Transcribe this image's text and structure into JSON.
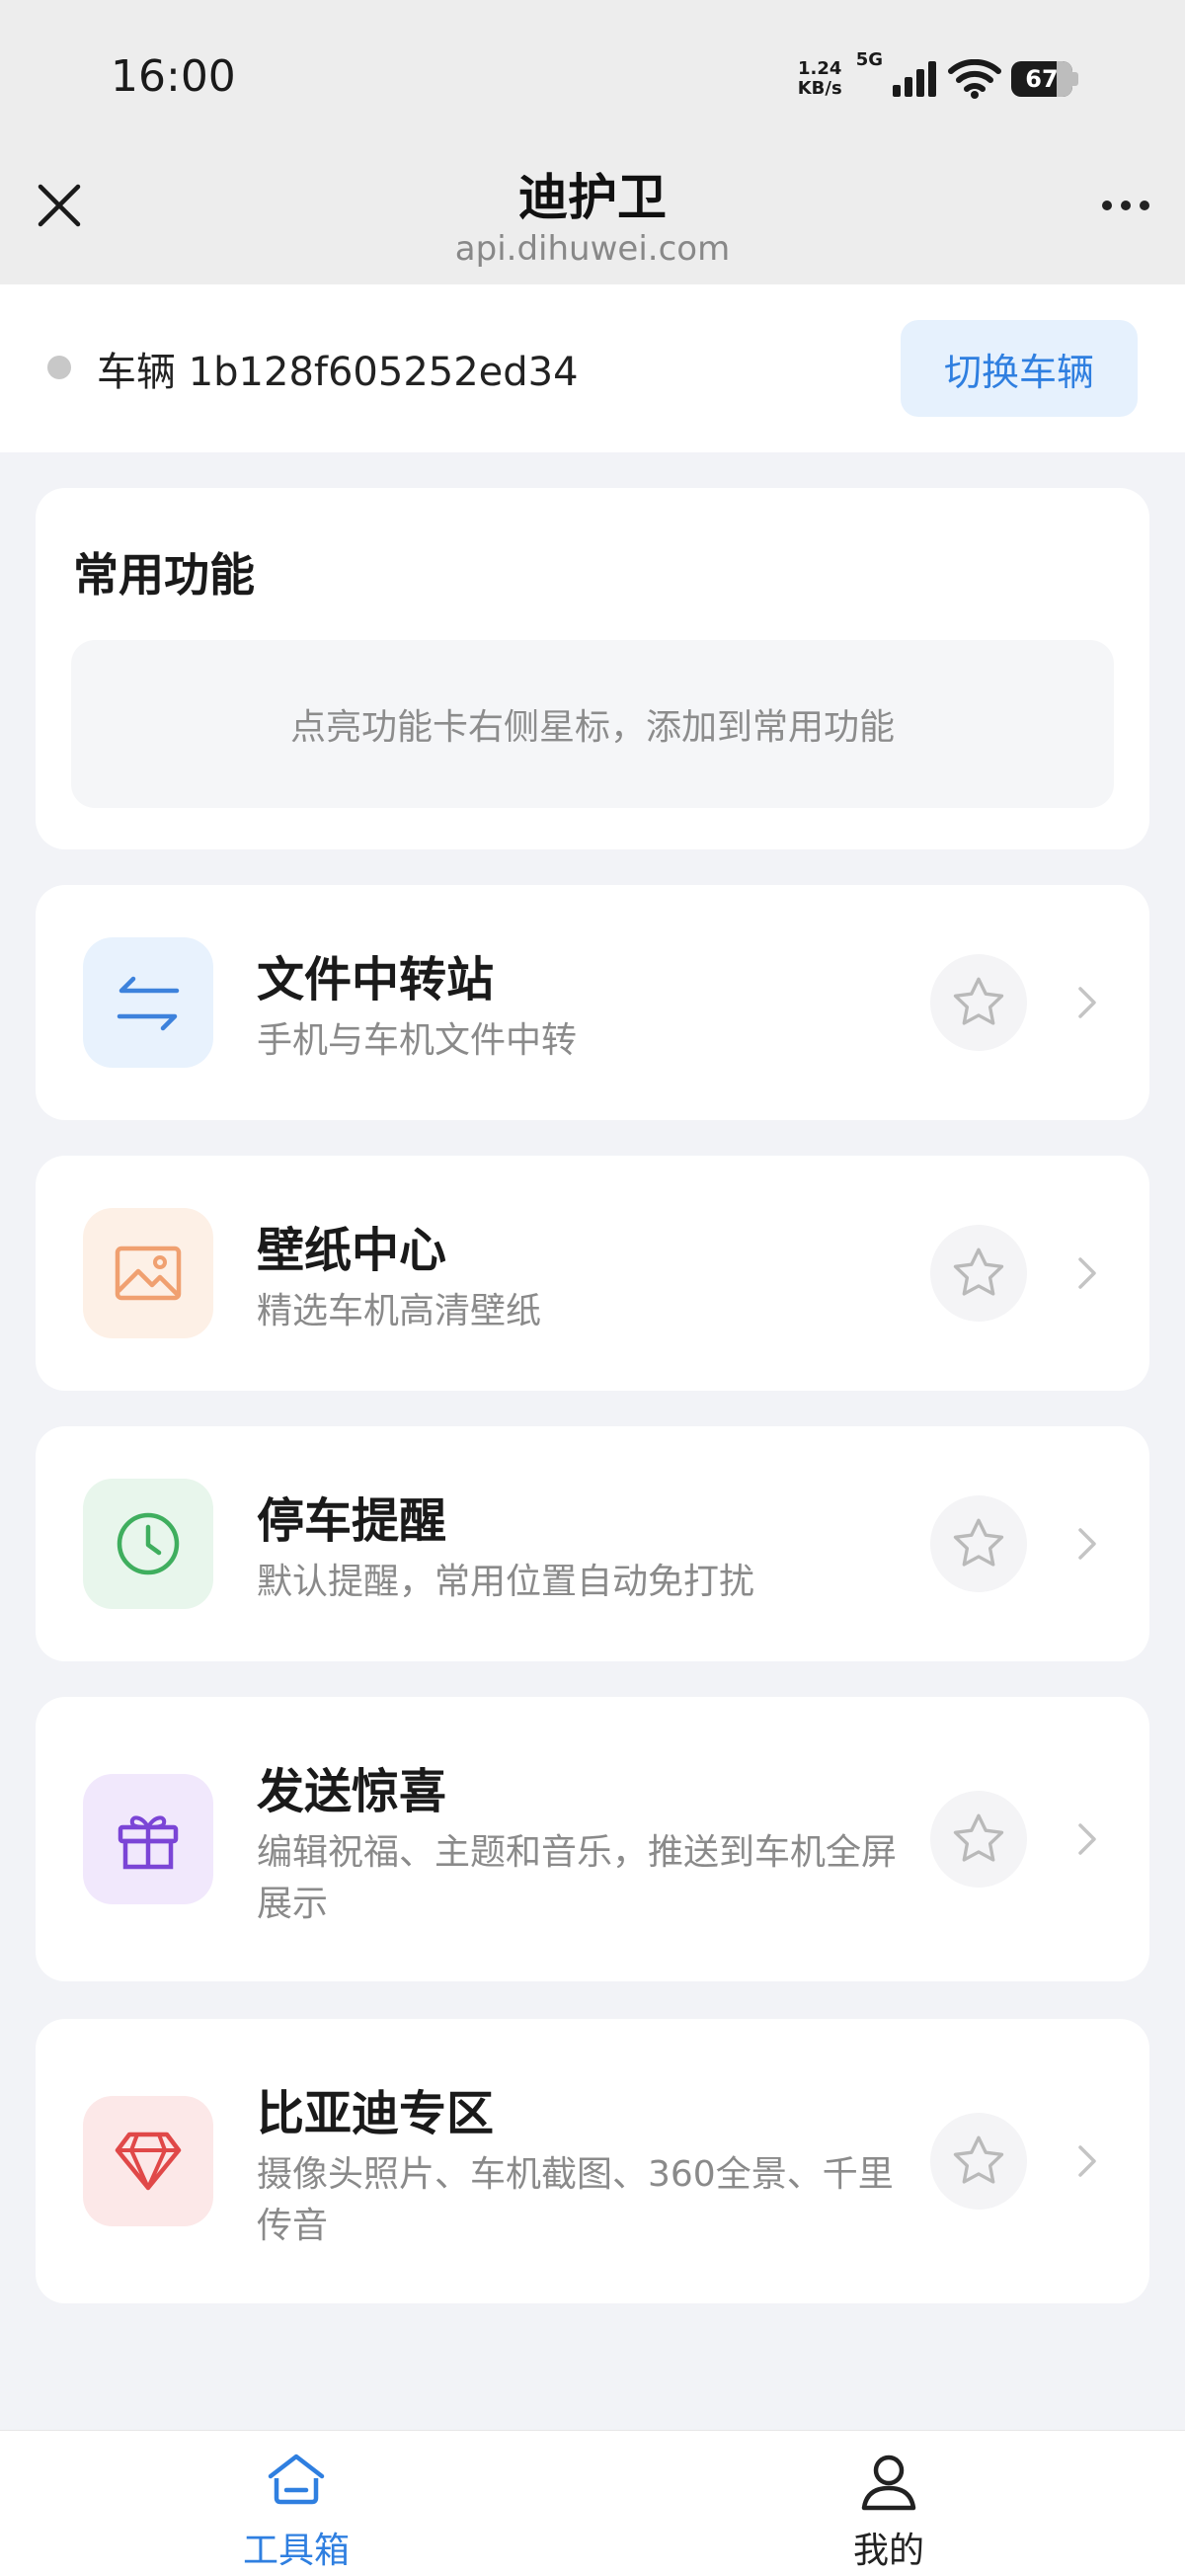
{
  "status": {
    "time": "16:00",
    "net_speed_value": "1.24",
    "net_speed_unit": "KB/s",
    "network_type": "5G",
    "battery": "67"
  },
  "titlebar": {
    "title": "迪护卫",
    "subtitle": "api.dihuwei.com"
  },
  "vehicle": {
    "label": "车辆 1b128f605252ed34",
    "switch_label": "切换车辆"
  },
  "common": {
    "title": "常用功能",
    "empty_hint": "点亮功能卡右侧星标，添加到常用功能"
  },
  "features": [
    {
      "name": "文件中转站",
      "desc": "手机与车机文件中转",
      "icon": "transfer-arrows-icon",
      "icon_color": "#3d82dc",
      "icon_bg": "#e8f2fd"
    },
    {
      "name": "壁纸中心",
      "desc": "精选车机高清壁纸",
      "icon": "image-icon",
      "icon_color": "#f0a070",
      "icon_bg": "#fdf0e6"
    },
    {
      "name": "停车提醒",
      "desc": "默认提醒，常用位置自动免打扰",
      "icon": "clock-icon",
      "icon_color": "#3fae5e",
      "icon_bg": "#e8f6ec"
    },
    {
      "name": "发送惊喜",
      "desc": "编辑祝福、主题和音乐，推送到车机全屏展示",
      "icon": "gift-icon",
      "icon_color": "#7b45d6",
      "icon_bg": "#f1e8fc"
    },
    {
      "name": "比亚迪专区",
      "desc": "摄像头照片、车机截图、360全景、千里传音",
      "icon": "diamond-icon",
      "icon_color": "#e04848",
      "icon_bg": "#fce8e8"
    }
  ],
  "tabs": [
    {
      "label": "工具箱",
      "icon": "home-icon",
      "active": true
    },
    {
      "label": "我的",
      "icon": "user-icon",
      "active": false
    }
  ],
  "colors": {
    "accent": "#2f7fe0",
    "page_bg": "#f2f3f7",
    "topbar_bg": "#ededed"
  }
}
